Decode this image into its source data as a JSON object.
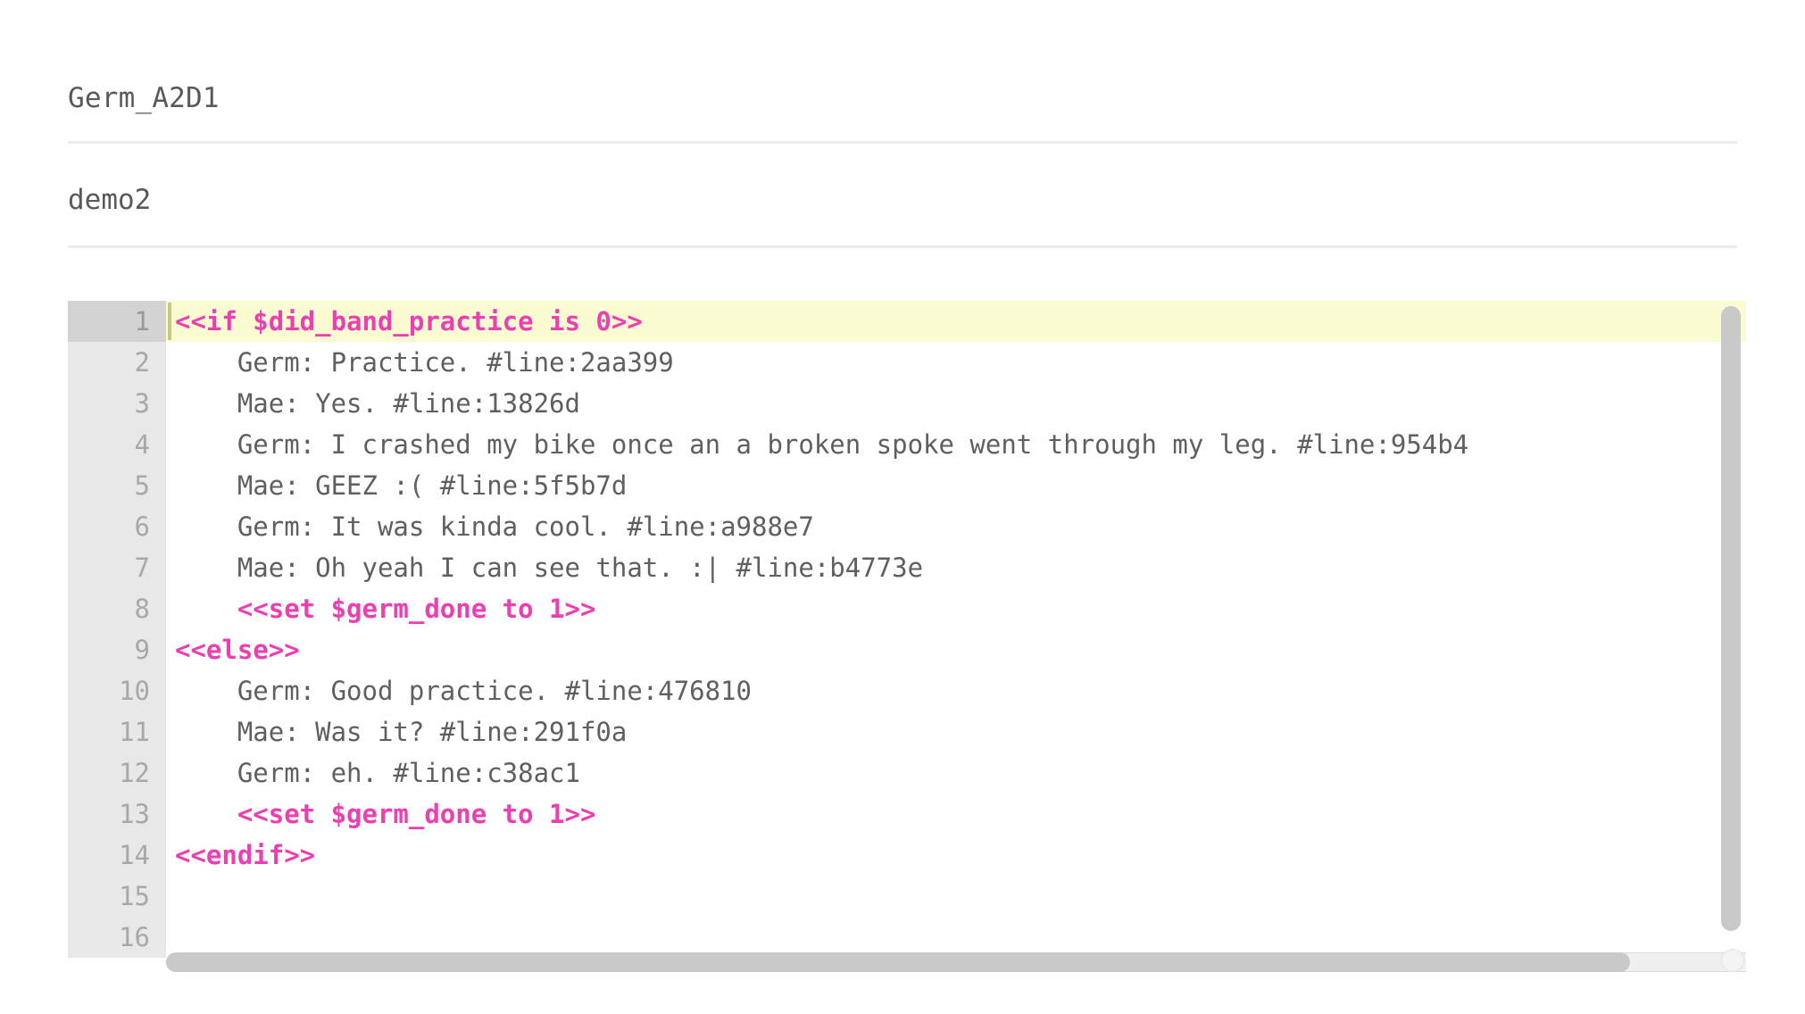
{
  "header": {
    "node_title": "Germ_A2D1",
    "tag_title": "demo2"
  },
  "editor": {
    "active_line": 1,
    "colors": {
      "macro": "#ec3fb1",
      "text": "#5f5f5f",
      "active_line_bg": "#fcfcd2",
      "gutter_bg": "#e8e8e8",
      "gutter_active_bg": "#d3d3d3",
      "cursor": "#c8c88a",
      "scrollbar_thumb": "#c9c9c9"
    },
    "lines": [
      {
        "n": "1",
        "indent": "",
        "type": "macro",
        "text": "<<if $did_band_practice is 0>>"
      },
      {
        "n": "2",
        "indent": "    ",
        "type": "text",
        "text": "Germ: Practice. #line:2aa399"
      },
      {
        "n": "3",
        "indent": "    ",
        "type": "text",
        "text": "Mae: Yes. #line:13826d"
      },
      {
        "n": "4",
        "indent": "    ",
        "type": "text",
        "text": "Germ: I crashed my bike once an a broken spoke went through my leg. #line:954b4"
      },
      {
        "n": "5",
        "indent": "    ",
        "type": "text",
        "text": "Mae: GEEZ :( #line:5f5b7d"
      },
      {
        "n": "6",
        "indent": "    ",
        "type": "text",
        "text": "Germ: It was kinda cool. #line:a988e7"
      },
      {
        "n": "7",
        "indent": "    ",
        "type": "text",
        "text": "Mae: Oh yeah I can see that. :| #line:b4773e"
      },
      {
        "n": "8",
        "indent": "    ",
        "type": "macro",
        "text": "<<set $germ_done to 1>>"
      },
      {
        "n": "9",
        "indent": "",
        "type": "macro",
        "text": "<<else>>"
      },
      {
        "n": "10",
        "indent": "    ",
        "type": "text",
        "text": "Germ: Good practice. #line:476810"
      },
      {
        "n": "11",
        "indent": "    ",
        "type": "text",
        "text": "Mae: Was it? #line:291f0a"
      },
      {
        "n": "12",
        "indent": "    ",
        "type": "text",
        "text": "Germ: eh. #line:c38ac1"
      },
      {
        "n": "13",
        "indent": "    ",
        "type": "macro",
        "text": "<<set $germ_done to 1>>"
      },
      {
        "n": "14",
        "indent": "",
        "type": "macro",
        "text": "<<endif>>"
      },
      {
        "n": "15",
        "indent": "",
        "type": "text",
        "text": ""
      },
      {
        "n": "16",
        "indent": "",
        "type": "text",
        "text": ""
      }
    ]
  }
}
